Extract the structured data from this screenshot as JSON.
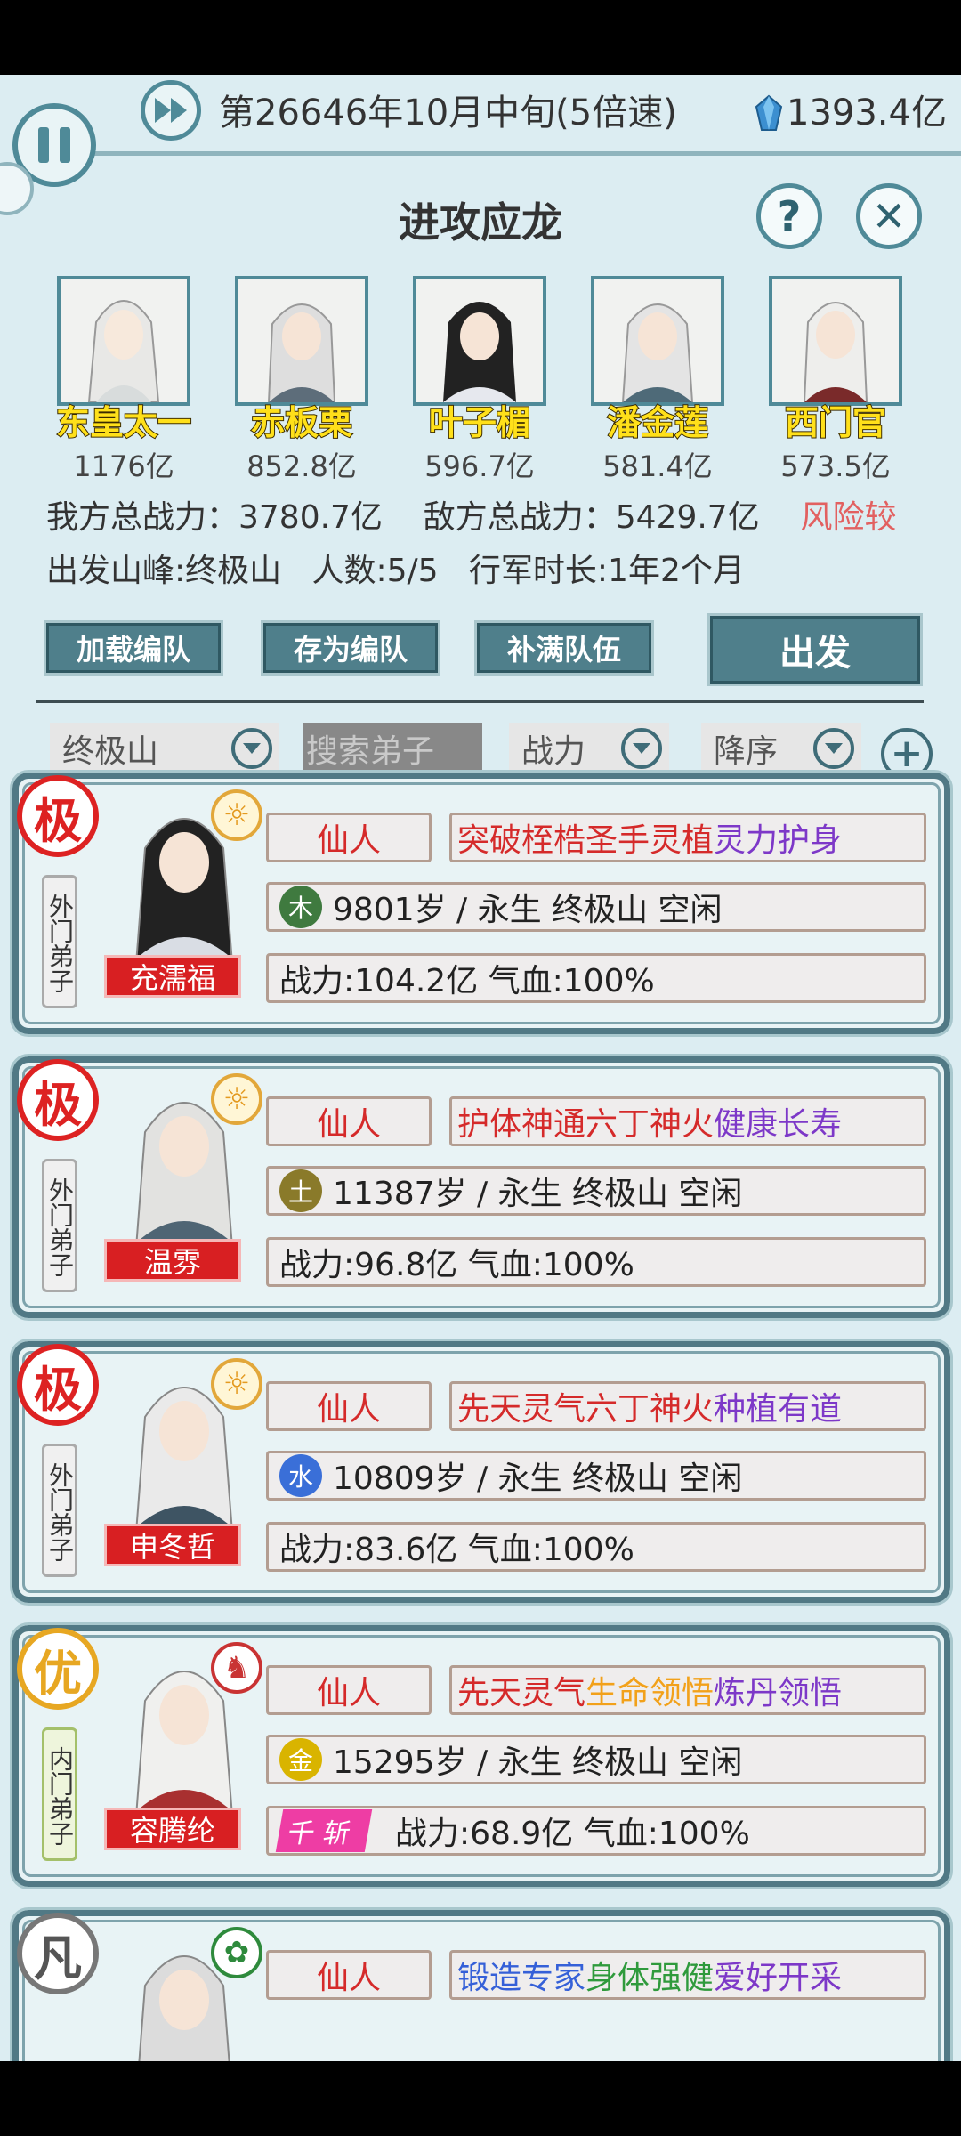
{
  "header": {
    "date": "第26646年10月中旬(5倍速)",
    "money": "1393.4亿",
    "title": "进攻应龙",
    "help_symbol": "?",
    "close_symbol": "✕"
  },
  "team": [
    {
      "name": "东皇太一",
      "power": "1176亿"
    },
    {
      "name": "赤板栗",
      "power": "852.8亿"
    },
    {
      "name": "叶子楣",
      "power": "596.7亿"
    },
    {
      "name": "潘金莲",
      "power": "581.4亿"
    },
    {
      "name": "西门官",
      "power": "573.5亿"
    }
  ],
  "summary": {
    "our_power": "我方总战力：3780.7亿",
    "enemy_power": "敌方总战力：5429.7亿",
    "risk": "风险较",
    "origin": "出发山峰:终极山",
    "count": "人数:5/5",
    "duration": "行军时长:1年2个月"
  },
  "actions": {
    "load": "加载编队",
    "save": "存为编队",
    "fill": "补满队伍",
    "depart": "出发"
  },
  "filters": {
    "mountain": "终极山",
    "search_placeholder": "搜索弟子",
    "sort_by": "战力",
    "order": "降序",
    "add": "+"
  },
  "disciples": [
    {
      "grade": "极",
      "grade_type": "ji",
      "rank": "外门弟子",
      "name": "充濡福",
      "badge": "sun",
      "class": "仙人",
      "traits": [
        {
          "text": "突破桎梏",
          "color": "red"
        },
        {
          "text": "圣手灵植",
          "color": "red"
        },
        {
          "text": "灵力护身",
          "color": "purple"
        }
      ],
      "element": "木",
      "element_color": "#3f7a3f",
      "info": "9801岁 / 永生  终极山  空闲",
      "stat": "战力:104.2亿  气血:100%"
    },
    {
      "grade": "极",
      "grade_type": "ji",
      "rank": "外门弟子",
      "name": "温雰",
      "badge": "sun",
      "class": "仙人",
      "traits": [
        {
          "text": "护体神通",
          "color": "red"
        },
        {
          "text": "六丁神火",
          "color": "red"
        },
        {
          "text": "健康长寿",
          "color": "purple"
        }
      ],
      "element": "土",
      "element_color": "#8a7a2a",
      "info": "11387岁 / 永生  终极山  空闲",
      "stat": "战力:96.8亿  气血:100%"
    },
    {
      "grade": "极",
      "grade_type": "ji",
      "rank": "外门弟子",
      "name": "申冬哲",
      "badge": "sun",
      "class": "仙人",
      "traits": [
        {
          "text": "先天灵气",
          "color": "red"
        },
        {
          "text": "六丁神火",
          "color": "red"
        },
        {
          "text": "种植有道",
          "color": "purple"
        }
      ],
      "element": "水",
      "element_color": "#3a6fd8",
      "info": "10809岁 / 永生  终极山  空闲",
      "stat": "战力:83.6亿  气血:100%"
    },
    {
      "grade": "优",
      "grade_type": "you",
      "rank": "内门弟子",
      "name": "容腾纶",
      "badge": "red",
      "class": "仙人",
      "traits": [
        {
          "text": "先天灵气",
          "color": "red"
        },
        {
          "text": "生命领悟",
          "color": "orange"
        },
        {
          "text": "炼丹领悟",
          "color": "purple"
        }
      ],
      "element": "金",
      "element_color": "#d9b400",
      "info": "15295岁 / 永生  终极山  空闲",
      "tag": "千斩",
      "stat": "战力:68.9亿  气血:100%"
    },
    {
      "grade": "凡",
      "grade_type": "fan",
      "rank": "",
      "name": "",
      "badge": "green",
      "class": "仙人",
      "traits": [
        {
          "text": "锻造专家",
          "color": "blue"
        },
        {
          "text": "身体强健",
          "color": "green"
        },
        {
          "text": "爱好开采",
          "color": "purple"
        }
      ],
      "element": "",
      "element_color": "#888",
      "info": "",
      "stat": ""
    }
  ]
}
